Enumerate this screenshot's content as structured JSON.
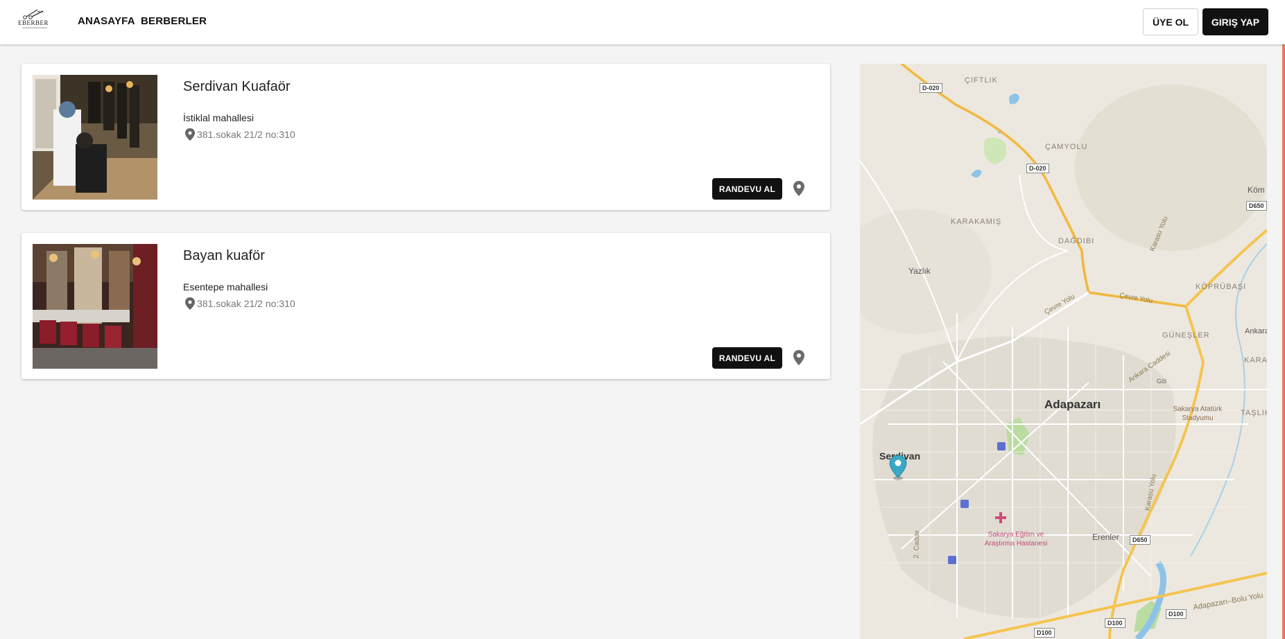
{
  "header": {
    "logo_text": "EBERBER",
    "nav": [
      {
        "label": "ANASAYFA"
      },
      {
        "label": "BERBERLER"
      }
    ],
    "signup_label": "ÜYE OL",
    "login_label": "GIRIŞ YAP"
  },
  "barbers": [
    {
      "name": "Serdivan Kuafaör",
      "district": "İstiklal mahallesi",
      "address": "381.sokak 21/2 no:310",
      "button_label": "RANDEVU AL"
    },
    {
      "name": "Bayan kuaför",
      "district": "Esentepe mahallesi",
      "address": "381.sokak 21/2 no:310",
      "button_label": "RANDEVU AL"
    }
  ],
  "map": {
    "labels": {
      "ciftlik": "ÇIFTLIK",
      "camyolu": "ÇAMYOLU",
      "karakamis": "KARAKAMIŞ",
      "dagdibi": "DAĞDIBI",
      "yazlik": "Yazlık",
      "kopru": "KÖPRÜBAŞI",
      "gunesler": "GÜNEŞLER",
      "cevre1": "Çevre Yolu",
      "cevre2": "Çevre Yolu",
      "ankara_cad": "Ankara Caddesi",
      "adapazari": "Adapazarı",
      "serdivan": "Serdivan",
      "stadium": "Sakarya Atatürk Stadyumu",
      "hospital": "Sakarya Eğitim ve Araştırma Hastanesi",
      "erenler": "Erenler",
      "karasu1": "Karasu Yolu",
      "karasu2": "Karasu Yolu",
      "cadde2": "2. Cadde",
      "kom": "Köm",
      "ankara": "Ankara",
      "karako": "KARAKÖ",
      "taslik": "TAŞLIK",
      "gol": "Göl",
      "bolu": "Adapazarı–Bolu Yolu"
    },
    "shields": {
      "d020a": "D-020",
      "d020b": "D-020",
      "d650a": "D650",
      "d650b": "D650",
      "d100a": "D100",
      "d100b": "D100",
      "d100c": "D100"
    }
  },
  "colors": {
    "accent_dark": "#111111",
    "map_marker": "#3aa7c6",
    "road_major": "#f5c451",
    "scroll_accent": "#e8795a"
  }
}
